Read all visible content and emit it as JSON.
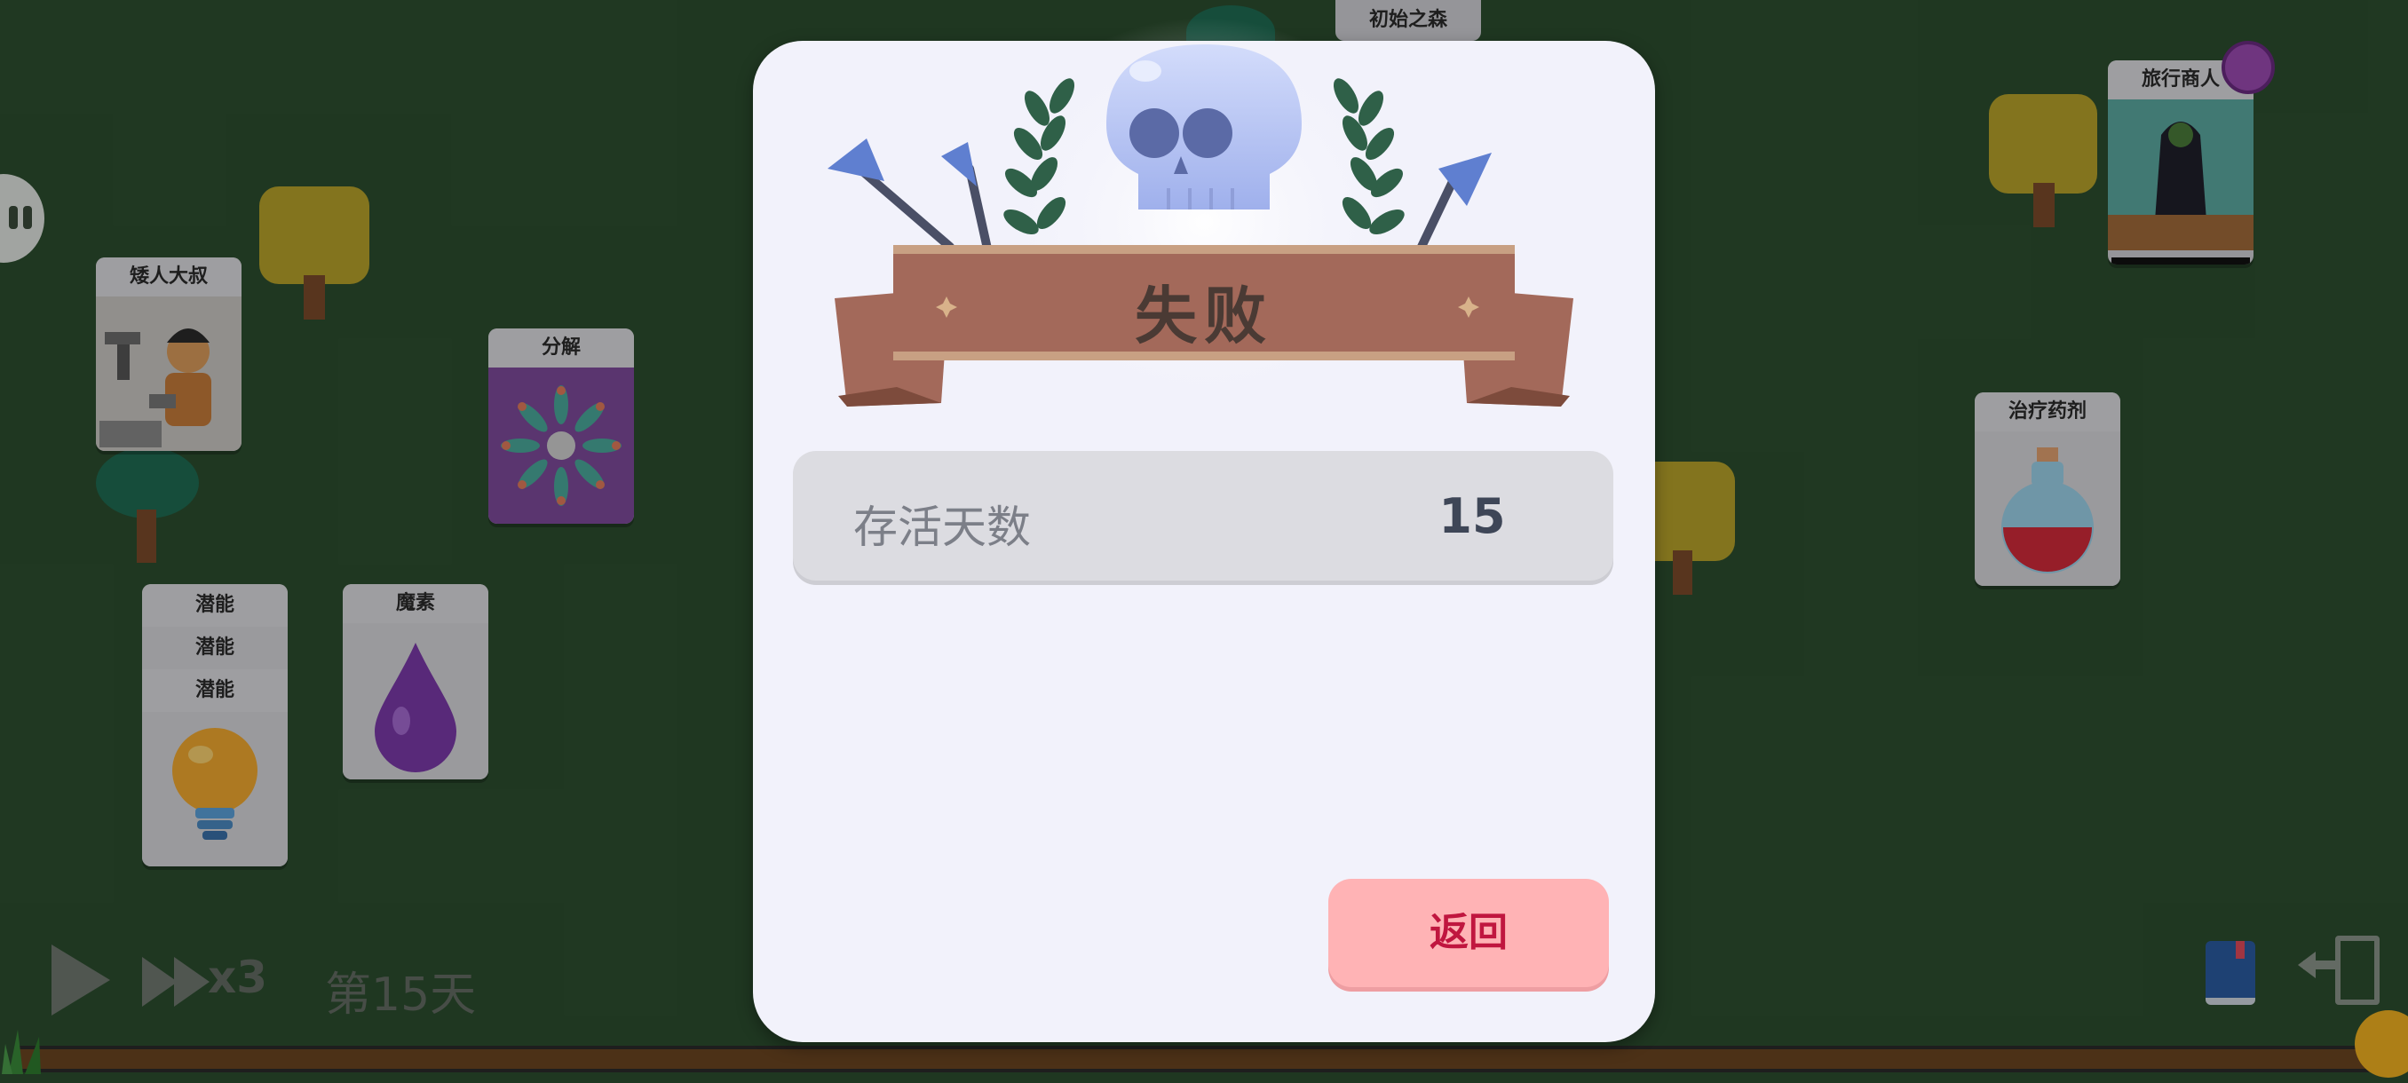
{
  "board": {
    "location_label": "初始之森",
    "cards": {
      "dwarf": "矮人大叔",
      "decompose": "分解",
      "potential_1": "潜能",
      "potential_2": "潜能",
      "potential_3": "潜能",
      "mana": "魔素",
      "merchant": "旅行商人",
      "potion": "治疗药剂"
    }
  },
  "hud": {
    "speed": "x3",
    "day": "第15天"
  },
  "modal": {
    "title": "失败",
    "stat_label": "存活天数",
    "stat_value": "15",
    "return_label": "返回"
  },
  "colors": {
    "background": "#2c4d2f",
    "modal_bg": "#f2f2fb",
    "ribbon": "#a3695a",
    "return_button": "#ffb3b5",
    "return_text": "#c0163f"
  }
}
